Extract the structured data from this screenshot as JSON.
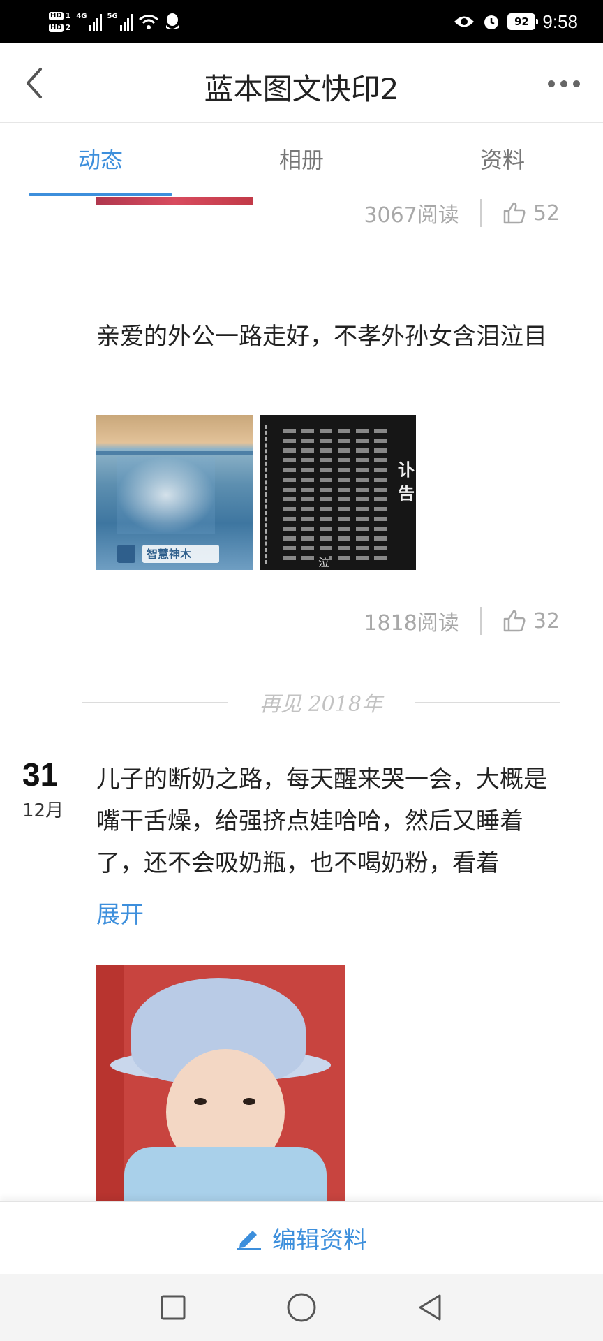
{
  "status_bar": {
    "hd_labels": [
      "HD",
      "HD"
    ],
    "sim_numbers": [
      "1",
      "2"
    ],
    "network_1": "4G",
    "network_2": "5G",
    "battery": "92",
    "time": "9:58"
  },
  "header": {
    "title": "蓝本图文快印2"
  },
  "tabs": [
    {
      "label": "动态",
      "active": true
    },
    {
      "label": "相册",
      "active": false
    },
    {
      "label": "资料",
      "active": false
    }
  ],
  "feed": {
    "post_prev": {
      "reads": "3067阅读",
      "likes": "52"
    },
    "post_1": {
      "text": "亲爱的外公一路走好，不孝外孙女含泪泣目",
      "reads": "1818阅读",
      "likes": "32",
      "image_text": [
        "智慧神木",
        "讣告",
        "泣"
      ]
    },
    "year_divider": "再见 2018年",
    "post_2": {
      "day": "31",
      "month": "12月",
      "text": "儿子的断奶之路，每天醒来哭一会，大概是嘴干舌燥，给强挤点娃哈哈，然后又睡着了，还不会吸奶瓶，也不喝奶粉，看着",
      "expand_label": "展开"
    }
  },
  "bottom": {
    "edit_label": "编辑资料"
  },
  "colors": {
    "accent": "#3d8fdc",
    "muted": "#a8a8a8"
  }
}
